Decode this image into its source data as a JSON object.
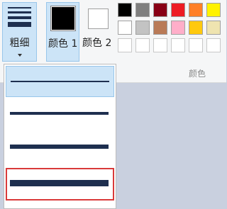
{
  "toolbar": {
    "size_label": "粗细",
    "color1_label": "颜色 1",
    "color2_label": "颜色 2",
    "colors_group_label": "颜色",
    "color1_value": "#000000",
    "color2_value": "#ffffff"
  },
  "palette": {
    "row1": [
      "#000000",
      "#7f7f7f",
      "#880015",
      "#ed1c24",
      "#ff7f27",
      "#fff200"
    ],
    "row2": [
      "#ffffff",
      "#c3c3c3",
      "#b97a57",
      "#ffaec9",
      "#ffc90e",
      "#efe4b0"
    ],
    "row3": [
      "",
      "",
      "",
      "",
      "",
      ""
    ]
  },
  "size_options": [
    {
      "name": "size-1",
      "selected": true,
      "hovered": false
    },
    {
      "name": "size-2",
      "selected": false,
      "hovered": false
    },
    {
      "name": "size-3",
      "selected": false,
      "hovered": false
    },
    {
      "name": "size-4",
      "selected": false,
      "hovered": true
    }
  ]
}
